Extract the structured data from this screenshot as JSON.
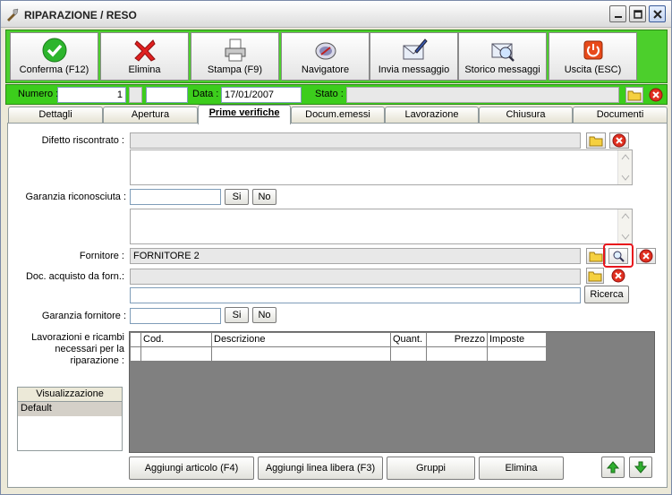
{
  "window": {
    "title": "RIPARAZIONE / RESO"
  },
  "toolbar": {
    "confirm": "Conferma (F12)",
    "delete": "Elimina",
    "print": "Stampa (F9)",
    "navigator": "Navigatore",
    "send_message": "Invia messaggio",
    "message_history": "Storico messaggi",
    "exit": "Uscita (ESC)"
  },
  "header": {
    "numero_label": "Numero :",
    "numero_value": "1",
    "data_label": "Data :",
    "data_value": "17/01/2007",
    "stato_label": "Stato :",
    "stato_value": ""
  },
  "tabs": [
    {
      "label": "Dettagli"
    },
    {
      "label": "Apertura"
    },
    {
      "label": "Prime verifiche"
    },
    {
      "label": "Docum.emessi"
    },
    {
      "label": "Lavorazione"
    },
    {
      "label": "Chiusura"
    },
    {
      "label": "Documenti"
    }
  ],
  "form": {
    "difetto_label": "Difetto riscontrato :",
    "difetto_value": "",
    "garanzia_label": "Garanzia riconosciuta :",
    "garanzia_value": "",
    "si": "Si",
    "no": "No",
    "fornitore_label": "Fornitore :",
    "fornitore_value": "FORNITORE 2",
    "doc_acquisto_label": "Doc. acquisto da forn.:",
    "doc_acquisto_value": "",
    "ricerca": "Ricerca",
    "garanzia_fornitore_label": "Garanzia fornitore :",
    "garanzia_fornitore_value": "",
    "lavorazioni_label": "Lavorazioni e ricambi necessari per la riparazione :"
  },
  "grid": {
    "columns": [
      "Cod.",
      "Descrizione",
      "Quant.",
      "Prezzo",
      "Imposte"
    ]
  },
  "view": {
    "header": "Visualizzazione",
    "items": [
      "Default"
    ]
  },
  "bottom": {
    "add_article": "Aggiungi articolo (F4)",
    "add_free_line": "Aggiungi linea libera (F3)",
    "groups": "Gruppi",
    "delete": "Elimina"
  },
  "colors": {
    "accent_green": "#3ccd1c",
    "highlight_red": "#e8141c"
  }
}
